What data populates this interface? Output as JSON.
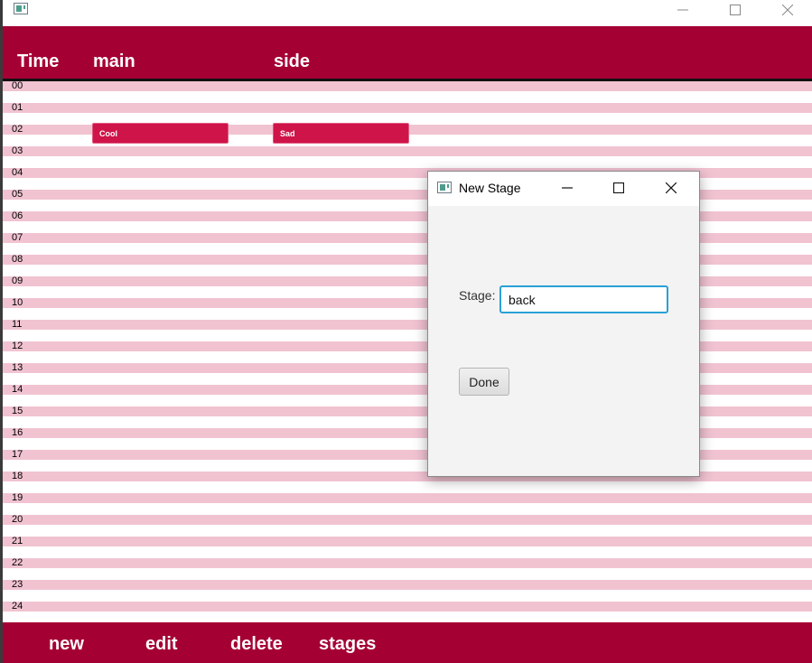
{
  "window": {
    "icon": "app-window-icon"
  },
  "header": {
    "time_label": "Time",
    "main_label": "main",
    "side_label": "side"
  },
  "hours": [
    "00",
    "01",
    "02",
    "03",
    "04",
    "05",
    "06",
    "07",
    "08",
    "09",
    "10",
    "11",
    "12",
    "13",
    "14",
    "15",
    "16",
    "17",
    "18",
    "19",
    "20",
    "21",
    "22",
    "23",
    "24"
  ],
  "events": [
    {
      "label": "Cool",
      "column": "main",
      "hour": "01"
    },
    {
      "label": "Sad",
      "column": "side",
      "hour": "01"
    }
  ],
  "footer": {
    "new_label": "new",
    "edit_label": "edit",
    "delete_label": "delete",
    "stages_label": "stages"
  },
  "dialog": {
    "title": "New Stage",
    "stage_label": "Stage:",
    "stage_value": "back",
    "done_label": "Done"
  },
  "colors": {
    "header": "#a50034",
    "stripe": "#f1c3d1",
    "event": "#cf1449",
    "focus": "#2aa0d8"
  }
}
